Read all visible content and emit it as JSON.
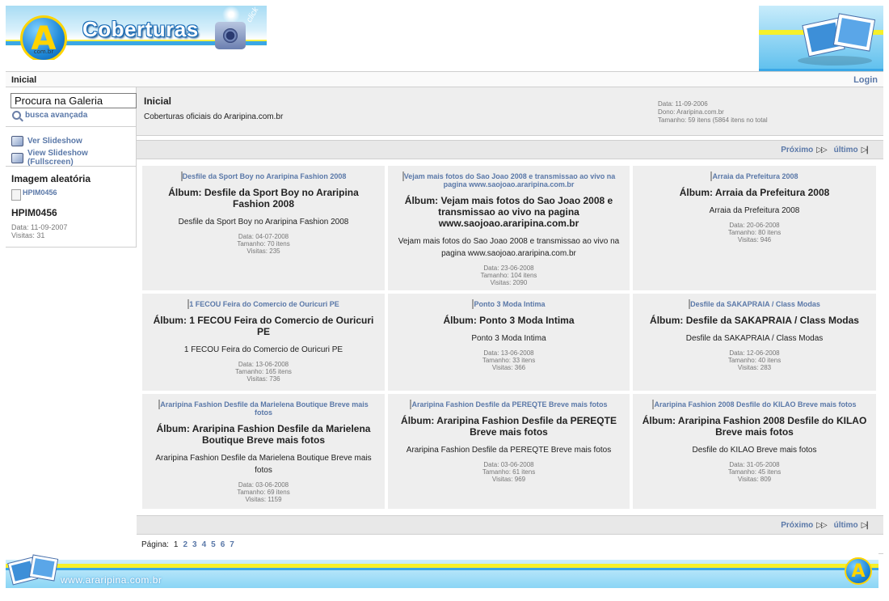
{
  "header": {
    "logo_letter": "A",
    "logo_sub": "com.br",
    "title": "Coberturas",
    "click_label": "click"
  },
  "nav": {
    "breadcrumb": "Inicial",
    "login": "Login"
  },
  "sidebar": {
    "search_value": "Procura na Galeria",
    "advanced_search": "busca avançada",
    "slideshow": "Ver Slideshow",
    "slideshow_full": "View Slideshow (Fullscreen)",
    "random_heading": "Imagem aleatória",
    "random_image_alt": "HPIM0456",
    "random_title": "HPIM0456",
    "random_date": "Data: 11-09-2007",
    "random_views": "Visitas: 31"
  },
  "album": {
    "title": "Inicial",
    "description": "Coberturas oficiais do Araripina.com.br",
    "date": "Data: 11-09-2006",
    "owner": "Dono: Araripina.com.br",
    "size": "Tamanho: 59 itens (5864 itens no total"
  },
  "pager": {
    "next": "Próximo",
    "last": "último"
  },
  "items": [
    {
      "thumb": "Desfile da Sport Boy no Araripina Fashion 2008",
      "title": "Álbum: Desfile da Sport Boy no Araripina Fashion 2008",
      "desc": "Desfile da Sport Boy no Araripina Fashion 2008",
      "date": "Data: 04-07-2008",
      "size": "Tamanho: 70 itens",
      "views": "Visitas: 235"
    },
    {
      "thumb": "Vejam mais fotos do Sao Joao 2008 e transmissao ao vivo na pagina www.saojoao.araripina.com.br",
      "title": "Álbum: Vejam mais fotos do Sao Joao 2008 e transmissao ao vivo na pagina www.saojoao.araripina.com.br",
      "desc": "Vejam mais fotos do Sao Joao 2008 e transmissao ao vivo na pagina www.saojoao.araripina.com.br",
      "date": "Data: 23-06-2008",
      "size": "Tamanho: 104 itens",
      "views": "Visitas: 2090"
    },
    {
      "thumb": "Arraia da Prefeitura 2008",
      "title": "Álbum: Arraia da Prefeitura 2008",
      "desc": "Arraia da Prefeitura 2008",
      "date": "Data: 20-06-2008",
      "size": "Tamanho: 80 itens",
      "views": "Visitas: 946"
    },
    {
      "thumb": "1 FECOU Feira do Comercio de Ouricuri PE",
      "title": "Álbum: 1 FECOU Feira do Comercio de Ouricuri PE",
      "desc": "1 FECOU Feira do Comercio de Ouricuri PE",
      "date": "Data: 13-06-2008",
      "size": "Tamanho: 165 itens",
      "views": "Visitas: 736"
    },
    {
      "thumb": "Ponto 3 Moda Intima",
      "title": "Álbum: Ponto 3 Moda Intima",
      "desc": "Ponto 3 Moda Intima",
      "date": "Data: 13-06-2008",
      "size": "Tamanho: 33 itens",
      "views": "Visitas: 366"
    },
    {
      "thumb": "Desfile da SAKAPRAIA / Class Modas",
      "title": "Álbum: Desfile da SAKAPRAIA / Class Modas",
      "desc": "Desfile da SAKAPRAIA / Class Modas",
      "date": "Data: 12-06-2008",
      "size": "Tamanho: 40 itens",
      "views": "Visitas: 283"
    },
    {
      "thumb": "Araripina Fashion Desfile da Marielena Boutique Breve mais fotos",
      "title": "Álbum: Araripina Fashion Desfile da Marielena Boutique Breve mais fotos",
      "desc": "Araripina Fashion Desfile da Marielena Boutique Breve mais fotos",
      "date": "Data: 03-06-2008",
      "size": "Tamanho: 69 itens",
      "views": "Visitas: 1159"
    },
    {
      "thumb": "Araripina Fashion Desfile da PEREQTE Breve mais fotos",
      "title": "Álbum: Araripina Fashion Desfile da PEREQTE Breve mais fotos",
      "desc": "Araripina Fashion Desfile da PEREQTE Breve mais fotos",
      "date": "Data: 03-06-2008",
      "size": "Tamanho: 61 itens",
      "views": "Visitas: 969"
    },
    {
      "thumb": "Araripina Fashion 2008 Desfile do KILAO Breve mais fotos",
      "title": "Álbum: Araripina Fashion 2008 Desfile do KILAO Breve mais fotos",
      "desc": "Desfile do KILAO Breve mais fotos",
      "date": "Data: 31-05-2008",
      "size": "Tamanho: 45 itens",
      "views": "Visitas: 809"
    }
  ],
  "pagination": {
    "label": "Página:",
    "current": "1",
    "pages": [
      "2",
      "3",
      "4",
      "5",
      "6",
      "7"
    ]
  },
  "footer": {
    "url": "www.araripina.com.br",
    "logo_letter": "A"
  },
  "colors": {
    "link": "#5a78a8",
    "panel": "#eeeeee",
    "banner_blue": "#3aa7e6",
    "banner_yellow": "#f6f02a"
  }
}
